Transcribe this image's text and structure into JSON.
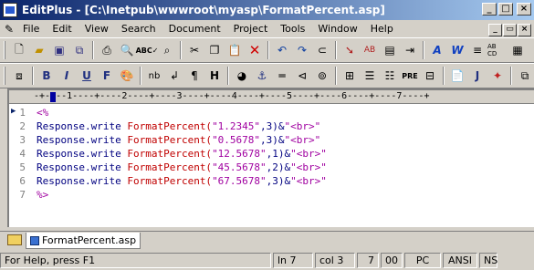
{
  "title": "EditPlus - [C:\\Inetpub\\wwwroot\\myasp\\FormatPercent.asp]",
  "menu": [
    "File",
    "Edit",
    "View",
    "Search",
    "Document",
    "Project",
    "Tools",
    "Window",
    "Help"
  ],
  "ruler": "-+----1----+----2----+----3----+----4----+----5----+----6----+----7----+",
  "lines": [
    {
      "num": "1",
      "parts": [
        {
          "t": "<%",
          "c": "kw-d"
        }
      ]
    },
    {
      "num": "2",
      "parts": [
        {
          "t": "Response.write ",
          "c": "kw-p"
        },
        {
          "t": "FormatPercent(",
          "c": "kw-r"
        },
        {
          "t": "\"1.2345\"",
          "c": "kw-d"
        },
        {
          "t": ",3)&",
          "c": "kw-p"
        },
        {
          "t": "\"<br>\"",
          "c": "kw-d"
        }
      ]
    },
    {
      "num": "3",
      "parts": [
        {
          "t": "Response.write ",
          "c": "kw-p"
        },
        {
          "t": "FormatPercent(",
          "c": "kw-r"
        },
        {
          "t": "\"0.5678\"",
          "c": "kw-d"
        },
        {
          "t": ",3)&",
          "c": "kw-p"
        },
        {
          "t": "\"<br>\"",
          "c": "kw-d"
        }
      ]
    },
    {
      "num": "4",
      "parts": [
        {
          "t": "Response.write ",
          "c": "kw-p"
        },
        {
          "t": "FormatPercent(",
          "c": "kw-r"
        },
        {
          "t": "\"12.5678\"",
          "c": "kw-d"
        },
        {
          "t": ",1)&",
          "c": "kw-p"
        },
        {
          "t": "\"<br>\"",
          "c": "kw-d"
        }
      ]
    },
    {
      "num": "5",
      "parts": [
        {
          "t": "Response.write ",
          "c": "kw-p"
        },
        {
          "t": "FormatPercent(",
          "c": "kw-r"
        },
        {
          "t": "\"45.5678\"",
          "c": "kw-d"
        },
        {
          "t": ",2)&",
          "c": "kw-p"
        },
        {
          "t": "\"<br>\"",
          "c": "kw-d"
        }
      ]
    },
    {
      "num": "6",
      "parts": [
        {
          "t": "Response.write ",
          "c": "kw-p"
        },
        {
          "t": "FormatPercent(",
          "c": "kw-r"
        },
        {
          "t": "\"67.5678\"",
          "c": "kw-d"
        },
        {
          "t": ",3)&",
          "c": "kw-p"
        },
        {
          "t": "\"<br>\"",
          "c": "kw-d"
        }
      ]
    },
    {
      "num": "7",
      "parts": [
        {
          "t": "%>",
          "c": "kw-d"
        }
      ]
    }
  ],
  "tab": "FormatPercent.asp",
  "status": {
    "help": "For Help, press F1",
    "ln": "ln 7",
    "col": "col 3",
    "n1": "7",
    "n2": "00",
    "pc": "PC",
    "enc": "ANSI",
    "ns": "NS"
  }
}
